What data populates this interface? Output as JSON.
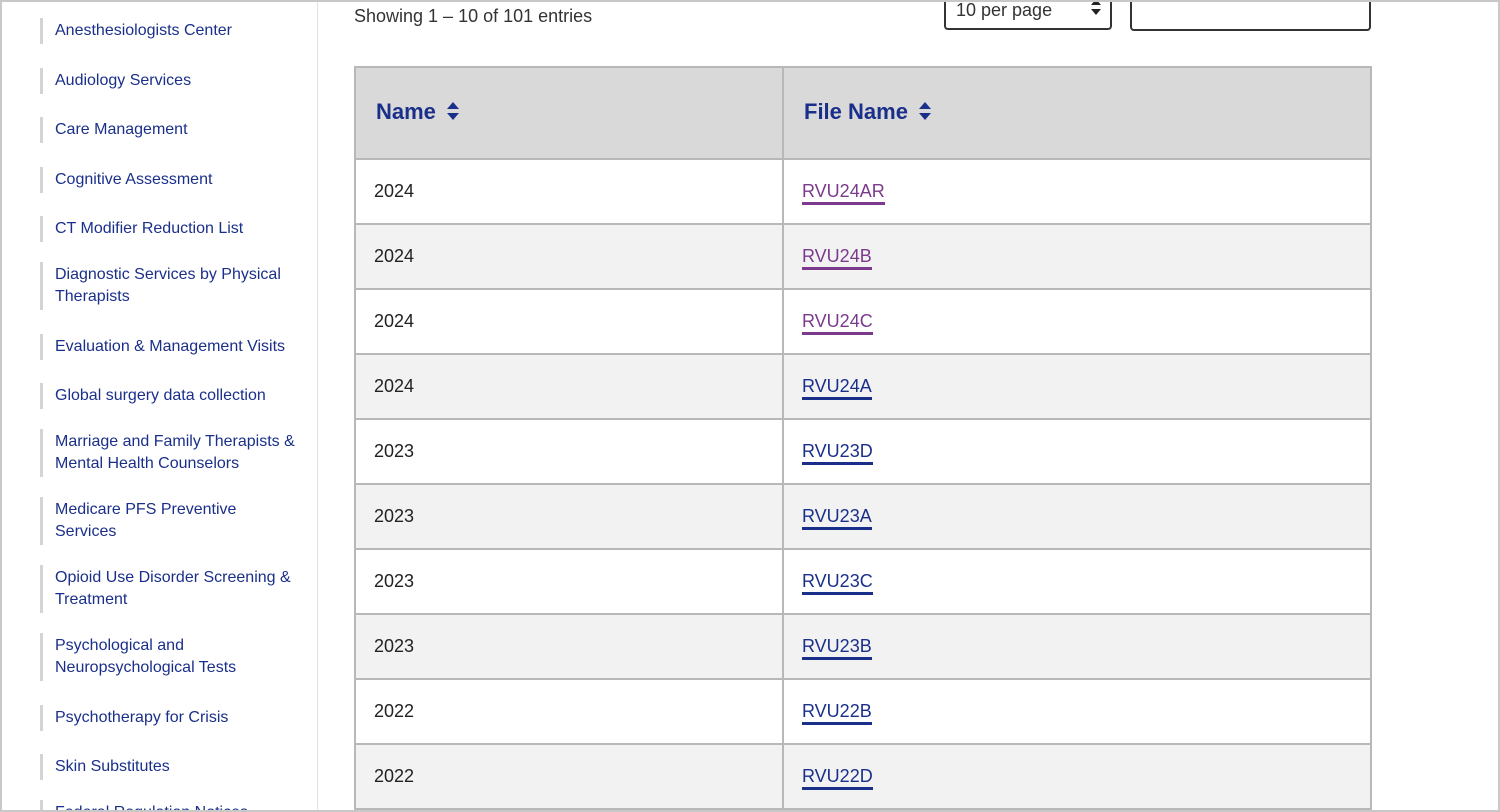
{
  "sidebar": {
    "items": [
      {
        "label": "Anesthesiologists Center"
      },
      {
        "label": "Audiology Services"
      },
      {
        "label": "Care Management"
      },
      {
        "label": "Cognitive Assessment"
      },
      {
        "label": "CT Modifier Reduction List"
      },
      {
        "label": "Diagnostic Services by Physical Therapists"
      },
      {
        "label": "Evaluation & Management Visits"
      },
      {
        "label": "Global surgery data collection"
      },
      {
        "label": "Marriage and Family Therapists & Mental Health Counselors"
      },
      {
        "label": "Medicare PFS Preventive Services"
      },
      {
        "label": "Opioid Use Disorder Screening & Treatment"
      },
      {
        "label": "Psychological and Neuropsychological Tests"
      },
      {
        "label": "Psychotherapy for Crisis"
      },
      {
        "label": "Skin Substitutes"
      },
      {
        "label": "Federal Regulation Notices"
      }
    ]
  },
  "main": {
    "showing_text": "Showing 1 – 10 of 101 entries",
    "per_page_label": "10 per page",
    "search_value": "",
    "table": {
      "headers": [
        "Name",
        "File Name"
      ],
      "rows": [
        {
          "name": "2024",
          "file": "RVU24AR",
          "visited": true
        },
        {
          "name": "2024",
          "file": "RVU24B",
          "visited": true
        },
        {
          "name": "2024",
          "file": "RVU24C",
          "visited": true
        },
        {
          "name": "2024",
          "file": "RVU24A",
          "visited": false
        },
        {
          "name": "2023",
          "file": "RVU23D",
          "visited": false
        },
        {
          "name": "2023",
          "file": "RVU23A",
          "visited": false
        },
        {
          "name": "2023",
          "file": "RVU23C",
          "visited": false
        },
        {
          "name": "2023",
          "file": "RVU23B",
          "visited": false
        },
        {
          "name": "2022",
          "file": "RVU22B",
          "visited": false
        },
        {
          "name": "2022",
          "file": "RVU22D",
          "visited": false
        }
      ]
    }
  },
  "icons": {
    "sort": "sort-updown-icon",
    "select": "chevron-updown-icon"
  },
  "colors": {
    "link": "#1a2f8a",
    "visited_link": "#7b3a8c",
    "header_bg": "#d9d9d9",
    "stripe": "#f2f2f2"
  }
}
